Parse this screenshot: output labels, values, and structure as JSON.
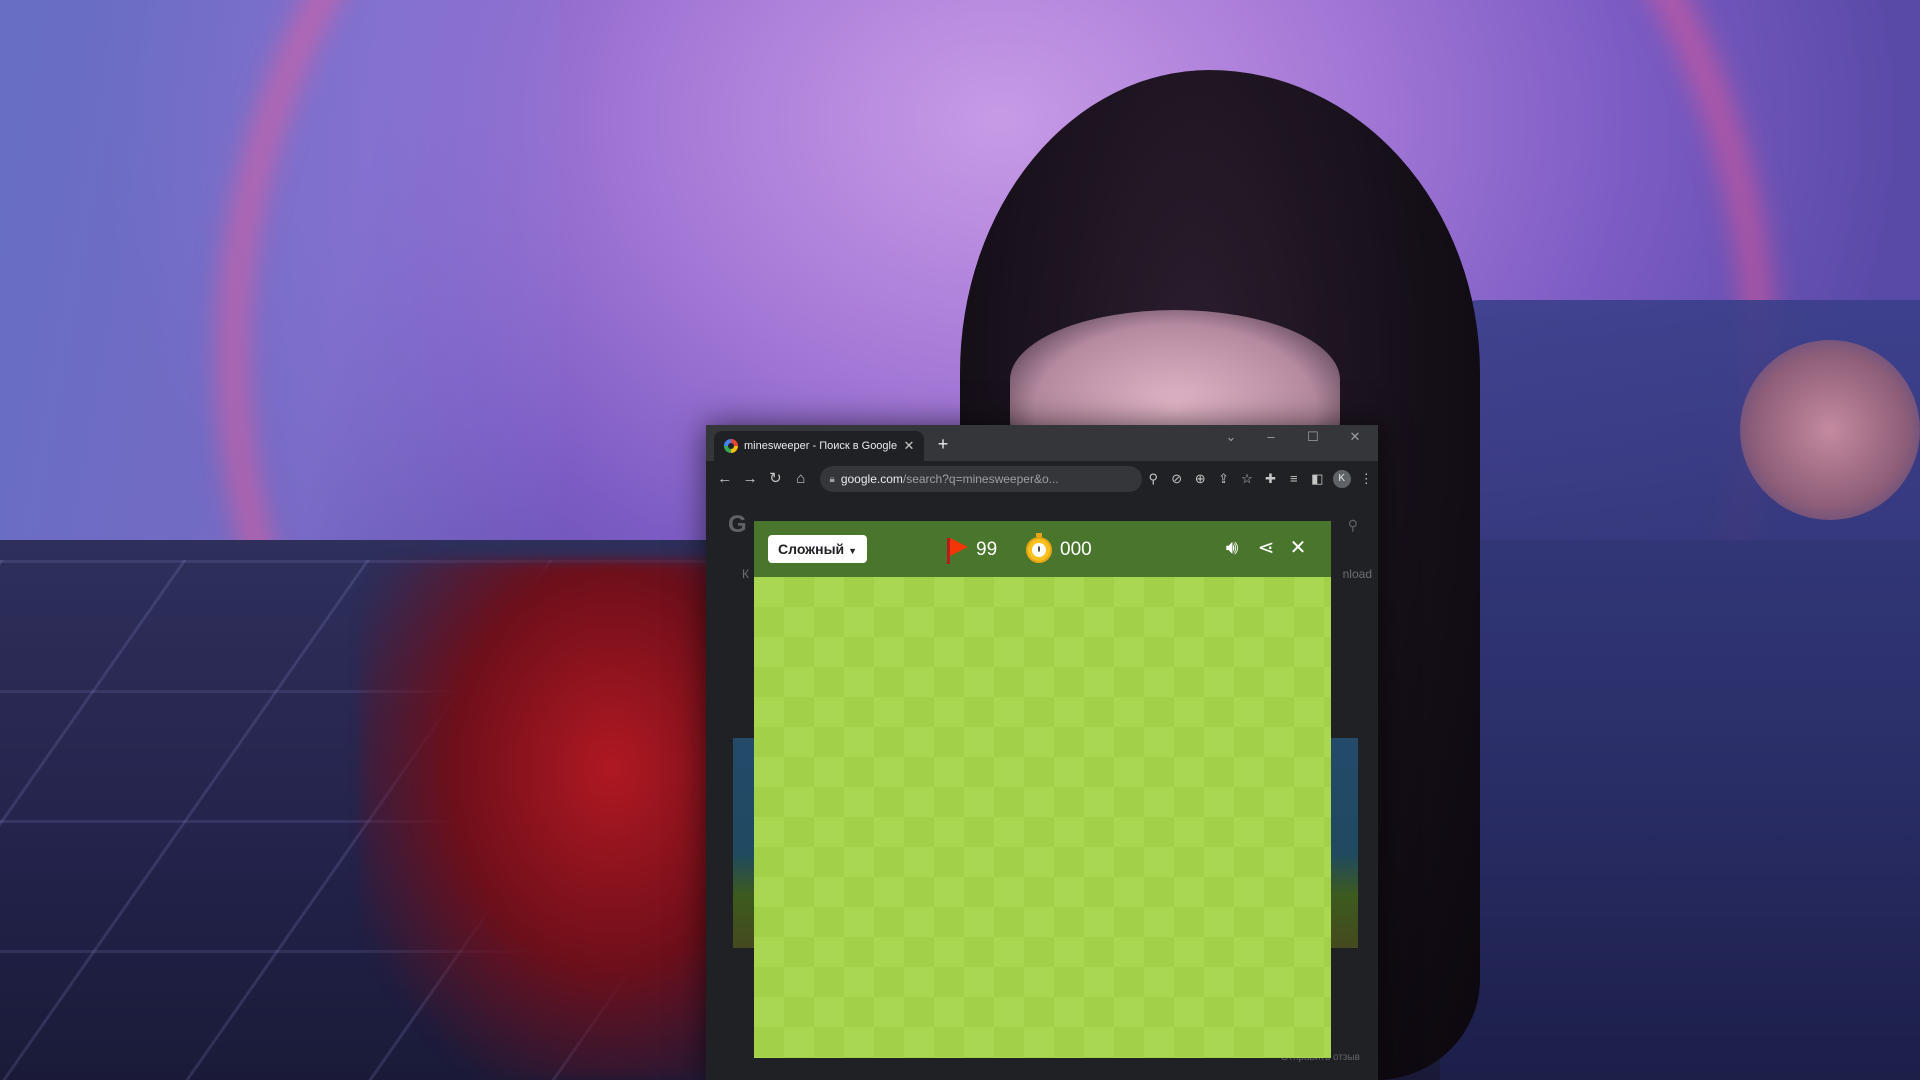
{
  "browser": {
    "tab_title": "minesweeper - Поиск в Google",
    "tab_close": "✕",
    "new_tab": "+",
    "window_controls": {
      "menu": "⌄",
      "minimize": "–",
      "maximize": "☐",
      "close": "✕"
    },
    "url_host": "google.com",
    "url_path": "/search?q=minesweeper&o...",
    "profile_initial": "K"
  },
  "page_behind": {
    "logo_fragment": "G",
    "tab_fragment_left": "К",
    "tab_fragment_right": "nload",
    "footer_fragment": "Отправить отзыв"
  },
  "game": {
    "difficulty": "Сложный",
    "flags_remaining": "99",
    "timer": "000",
    "colors": {
      "header": "#4a752c",
      "tile_light": "#aad751",
      "tile_dark": "#a2d149",
      "flag": "#f23607",
      "clock": "#f9c11d"
    }
  },
  "icons": {
    "back": "arrow-left-icon",
    "forward": "arrow-right-icon",
    "reload": "reload-icon",
    "home": "home-icon",
    "lock": "lock-icon",
    "location": "location-icon",
    "zoom": "zoom-icon",
    "share": "share-icon",
    "star": "star-icon",
    "extensions": "puzzle-icon",
    "sound": "speaker-icon",
    "close": "close-icon"
  }
}
